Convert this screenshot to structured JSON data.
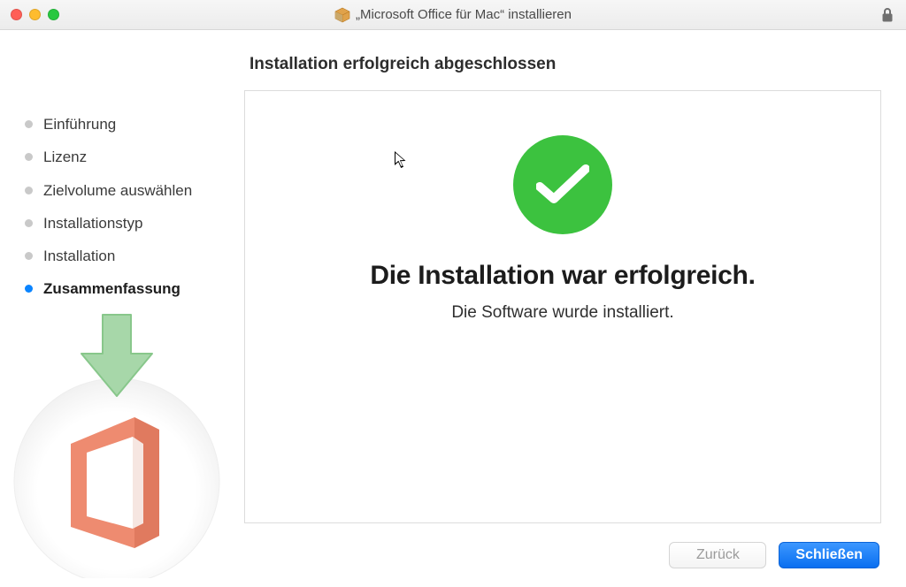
{
  "window": {
    "title": "„Microsoft Office für Mac“ installieren"
  },
  "sidebar": {
    "items": [
      {
        "label": "Einführung",
        "active": false
      },
      {
        "label": "Lizenz",
        "active": false
      },
      {
        "label": "Zielvolume auswählen",
        "active": false
      },
      {
        "label": "Installationstyp",
        "active": false
      },
      {
        "label": "Installation",
        "active": false
      },
      {
        "label": "Zusammenfassung",
        "active": true
      }
    ]
  },
  "main": {
    "heading": "Installation erfolgreich abgeschlossen",
    "success_title": "Die Installation war erfolgreich.",
    "success_sub": "Die Software wurde installiert."
  },
  "footer": {
    "back_label": "Zurück",
    "close_label": "Schließen"
  },
  "icons": {
    "package": "package-icon",
    "lock": "lock-icon",
    "check": "check-icon",
    "office": "office-icon",
    "arrow_down": "arrow-down-icon",
    "cursor": "cursor-icon"
  },
  "colors": {
    "accent_primary": "#0a6ff0",
    "success_green": "#3cc23f",
    "office_orange": "#ee8b70",
    "arrow_green": "#a7d7a9"
  }
}
